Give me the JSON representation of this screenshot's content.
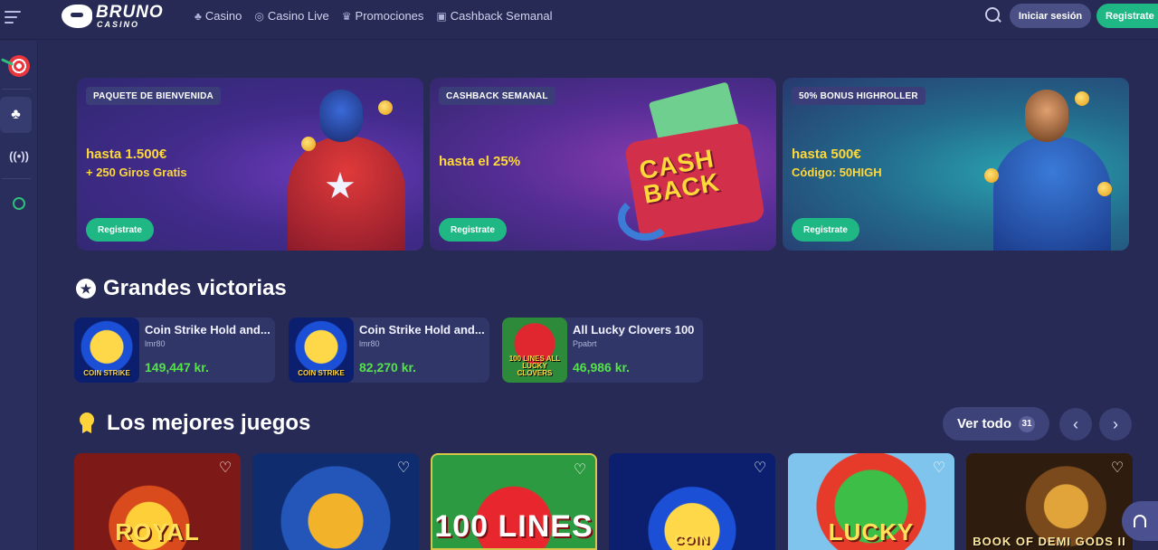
{
  "header": {
    "brand": "BRUNO",
    "brand_sub": "CASINO",
    "nav": [
      {
        "label": "Casino",
        "icon": "cherry-icon"
      },
      {
        "label": "Casino Live",
        "icon": "live-icon"
      },
      {
        "label": "Promociones",
        "icon": "crown-icon"
      },
      {
        "label": "Cashback Semanal",
        "icon": "gift-icon"
      }
    ],
    "login_label": "Iniciar sesión",
    "register_label": "Registrate"
  },
  "sidebar": {
    "items": [
      {
        "name": "target-icon"
      },
      {
        "name": "cherry-icon"
      },
      {
        "name": "live-icon"
      },
      {
        "name": "headset-icon"
      }
    ]
  },
  "banners": [
    {
      "tag": "PAQUETE DE BIENVENIDA",
      "headline": "hasta 1.500€",
      "subline": "+ 250 Giros Gratis",
      "button": "Registrate"
    },
    {
      "tag": "CASHBACK SEMANAL",
      "headline": "hasta el 25%",
      "subline": "",
      "button": "Registrate",
      "art_text": "CASH BACK"
    },
    {
      "tag": "50% BONUS HIGHROLLER",
      "headline": "hasta 500€",
      "subline": "Código: 50HIGH",
      "button": "Registrate"
    }
  ],
  "big_wins": {
    "title": "Grandes victorias",
    "items": [
      {
        "game": "Coin Strike Hold and...",
        "provider": "lmr80",
        "amount": "149,447 kr.",
        "thumb_text": "COIN STRIKE"
      },
      {
        "game": "Coin Strike Hold and...",
        "provider": "lmr80",
        "amount": "82,270 kr.",
        "thumb_text": "COIN STRIKE"
      },
      {
        "game": "All Lucky Clovers 100",
        "provider": "Ppabrt",
        "amount": "46,986 kr.",
        "thumb_text": "100 LINES ALL LUCKY CLOVERS"
      }
    ]
  },
  "best_games": {
    "title": "Los mejores juegos",
    "view_all_label": "Ver todo",
    "view_all_count": "31",
    "games": [
      {
        "label": "ROYAL"
      },
      {
        "label": ""
      },
      {
        "label": "100 LINES"
      },
      {
        "label": "COIN"
      },
      {
        "label": "LUCKY"
      },
      {
        "label": "BOOK OF DEMI GODS II"
      }
    ]
  },
  "colors": {
    "background": "#262a55",
    "accent_green": "#1fb884",
    "amount_green": "#55e24a",
    "promo_yellow": "#ffd83a"
  }
}
